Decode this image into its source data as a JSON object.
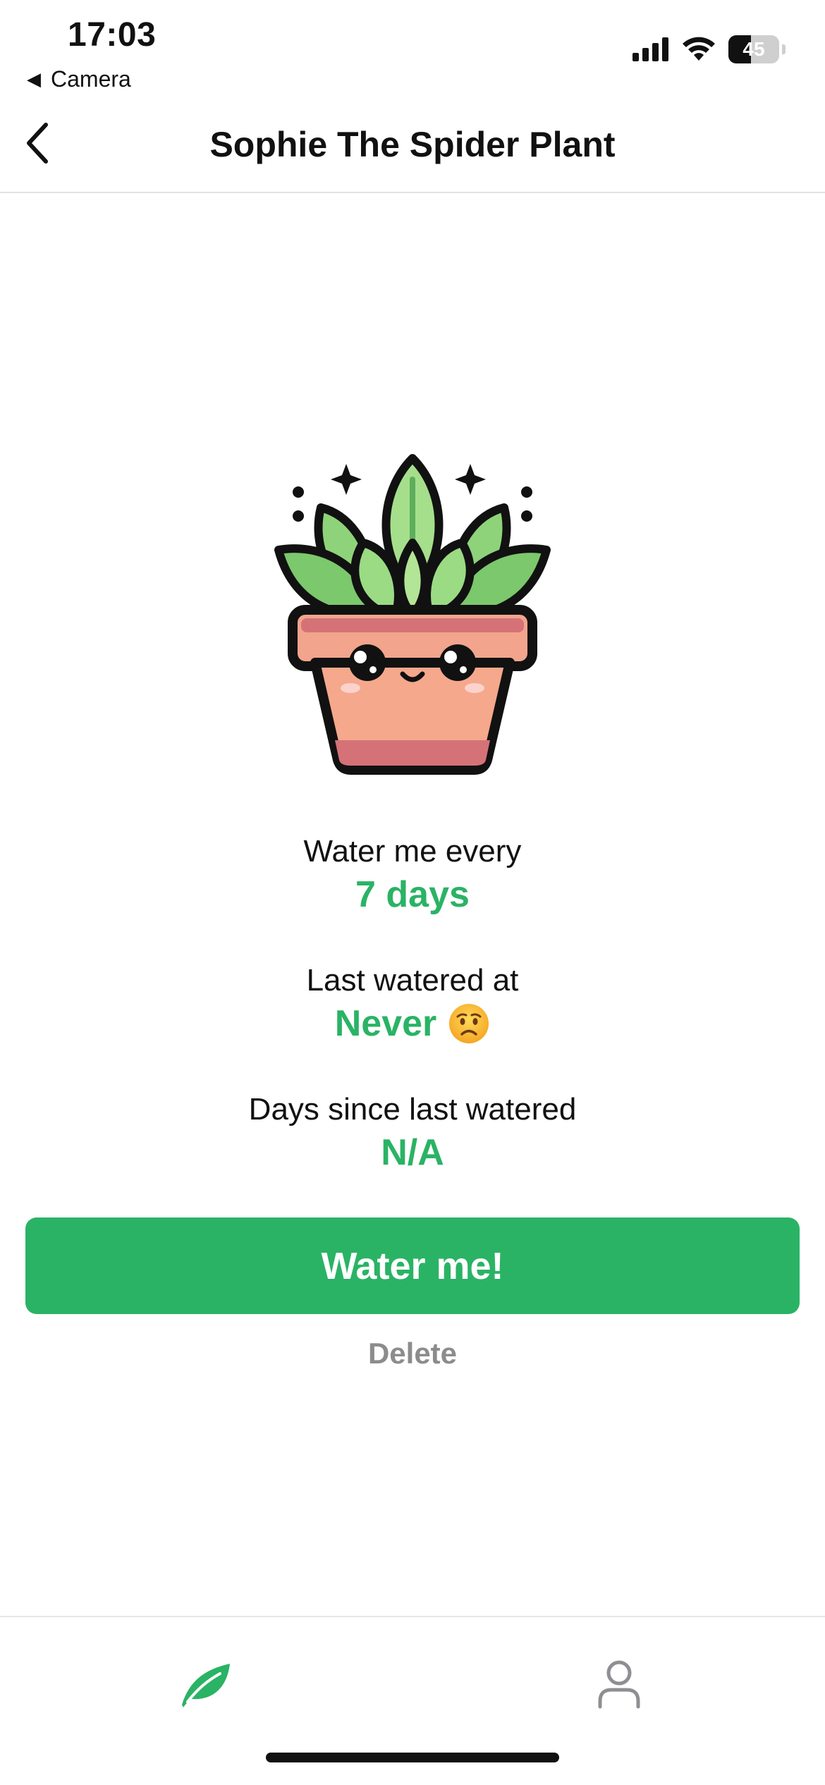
{
  "status_bar": {
    "time": "17:03",
    "back_app_label": "Camera",
    "battery_level": "45"
  },
  "nav": {
    "title": "Sophie The Spider Plant",
    "back_icon": "chevron-left-icon"
  },
  "plant": {
    "image_icon": "potted-plant-illustration"
  },
  "details": {
    "water_every_label": "Water me every",
    "water_every_value": "7 days",
    "last_watered_label": "Last watered at",
    "last_watered_value": "Never",
    "last_watered_emoji": "worried-face-emoji",
    "days_since_label": "Days since last watered",
    "days_since_value": "N/A"
  },
  "actions": {
    "water_button_label": "Water me!",
    "delete_label": "Delete"
  },
  "tab_bar": {
    "tabs": [
      {
        "name": "plants",
        "icon": "leaf-icon",
        "active": true
      },
      {
        "name": "profile",
        "icon": "person-icon",
        "active": false
      }
    ]
  },
  "colors": {
    "accent": "#2ab365",
    "muted": "#8c8c8c",
    "inactive_icon": "#8e8e93"
  }
}
